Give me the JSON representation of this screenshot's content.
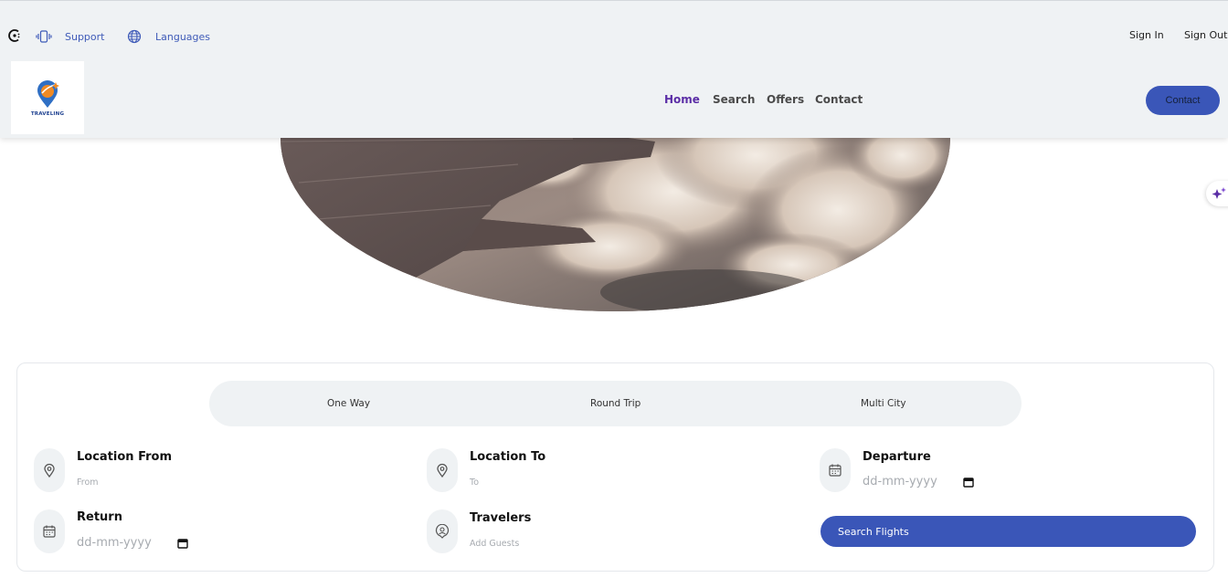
{
  "topbar": {
    "support_label": "Support",
    "languages_label": "Languages",
    "sign_in_label": "Sign In",
    "sign_out_label": "Sign Out"
  },
  "logo": {
    "text": "TRAVELING"
  },
  "nav": {
    "items": [
      {
        "label": "Home",
        "active": true
      },
      {
        "label": "Search",
        "active": false
      },
      {
        "label": "Offers",
        "active": false
      },
      {
        "label": "Contact",
        "active": false
      }
    ]
  },
  "contact_button": {
    "label": "Contact"
  },
  "hero": {
    "image": "airplane-wing-over-clouds"
  },
  "trip_types": [
    "One Way",
    "Round Trip",
    "Multi City"
  ],
  "fields": {
    "location_from": {
      "label": "Location From",
      "placeholder": "From"
    },
    "location_to": {
      "label": "Location To",
      "placeholder": "To"
    },
    "departure": {
      "label": "Departure",
      "placeholder": "dd-mm-yyyy"
    },
    "return": {
      "label": "Return",
      "placeholder": "dd-mm-yyyy"
    },
    "travelers": {
      "label": "Travelers",
      "placeholder": "Add Guests"
    }
  },
  "search_button": {
    "label": "Search Flights"
  },
  "colors": {
    "accent": "#3a56b8",
    "nav_active": "#5b2ea6",
    "surface": "#eff2f4"
  }
}
